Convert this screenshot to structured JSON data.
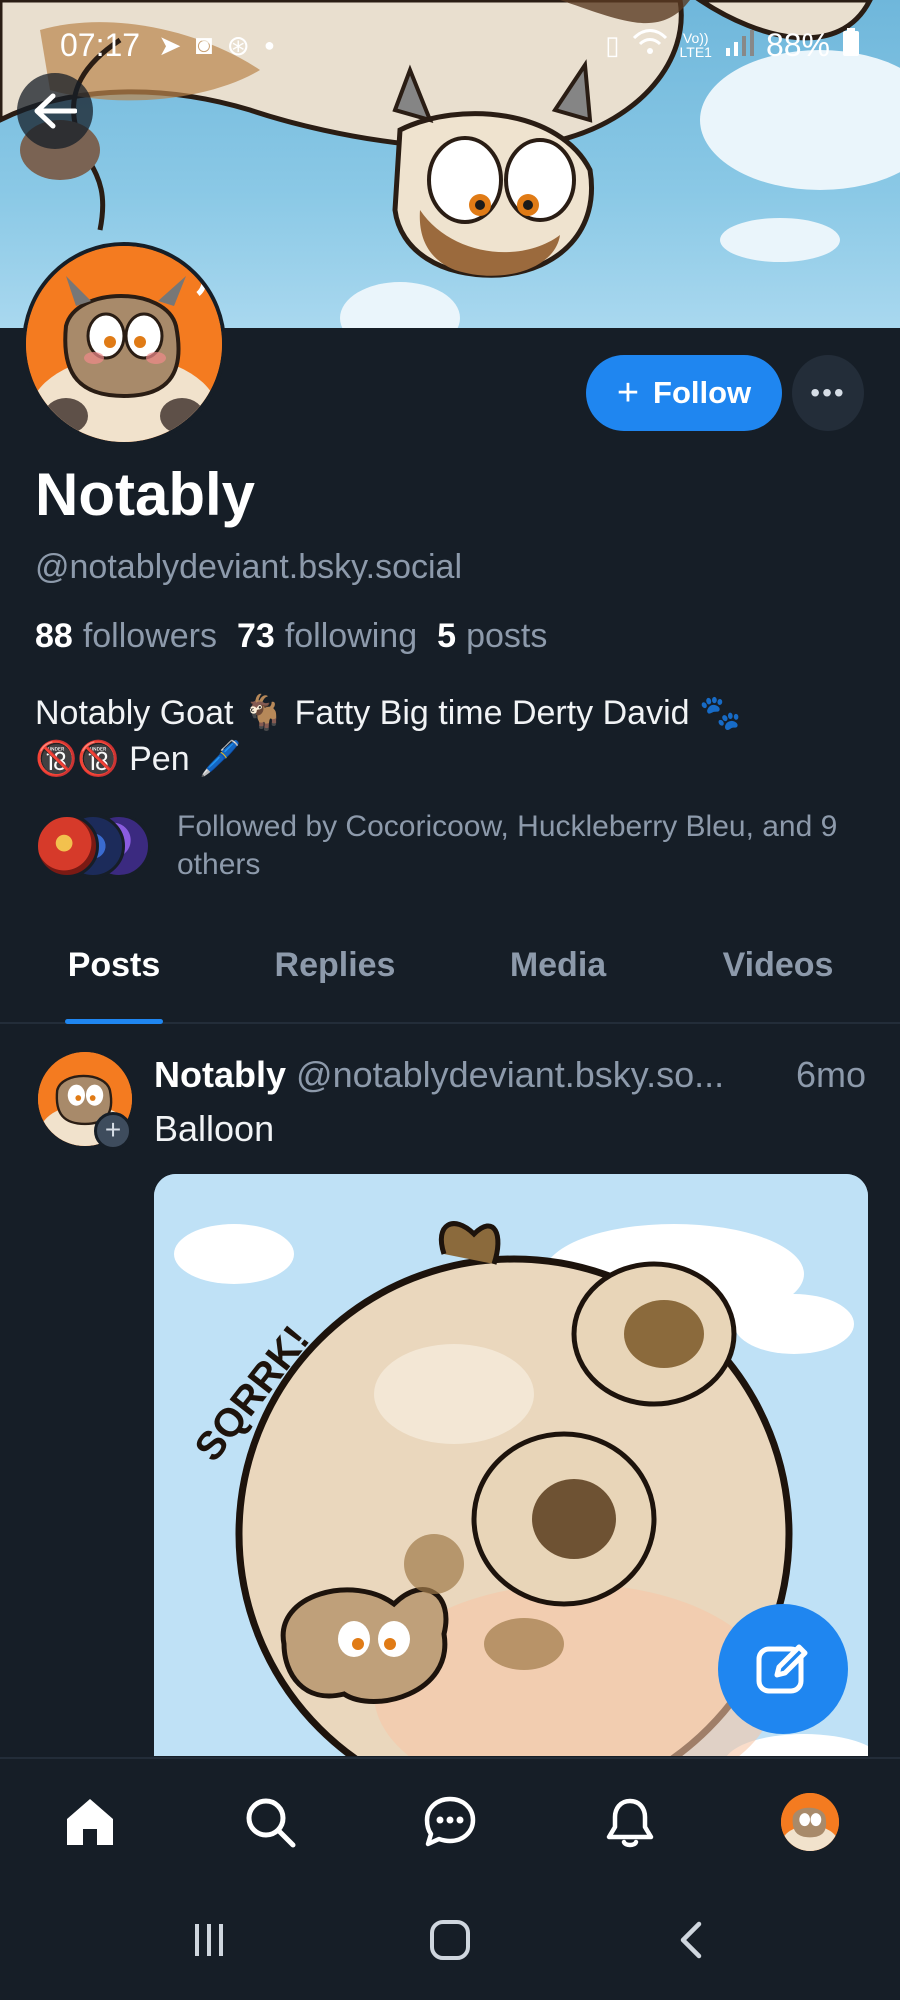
{
  "status_bar": {
    "time": "07:17",
    "network_top": "Vo))",
    "network_bottom": "LTE1",
    "battery": "88%"
  },
  "profile": {
    "display_name": "Notably",
    "handle": "@notablydeviant.bsky.social",
    "follow_label": "Follow",
    "stats": {
      "followers_count": "88",
      "followers_label": "followers",
      "following_count": "73",
      "following_label": "following",
      "posts_count": "5",
      "posts_label": "posts"
    },
    "bio_line1": "Notably Goat 🐐 Fatty Big time Derty David 🐾",
    "bio_line2": "🔞🔞 Pen 🖊️",
    "followed_by": "Followed by Cocoricoow, Huckleberry Bleu, and 9 others"
  },
  "tabs": [
    {
      "label": "Posts"
    },
    {
      "label": "Replies"
    },
    {
      "label": "Media"
    },
    {
      "label": "Videos"
    }
  ],
  "post": {
    "author": "Notably",
    "handle": "@notablydeviant.bsky.so...",
    "time": "6mo",
    "text": "Balloon",
    "image_caption": "SQRRK!"
  },
  "colors": {
    "background": "#161e27",
    "accent": "#1f86f0",
    "muted_text": "#8d9aab"
  }
}
